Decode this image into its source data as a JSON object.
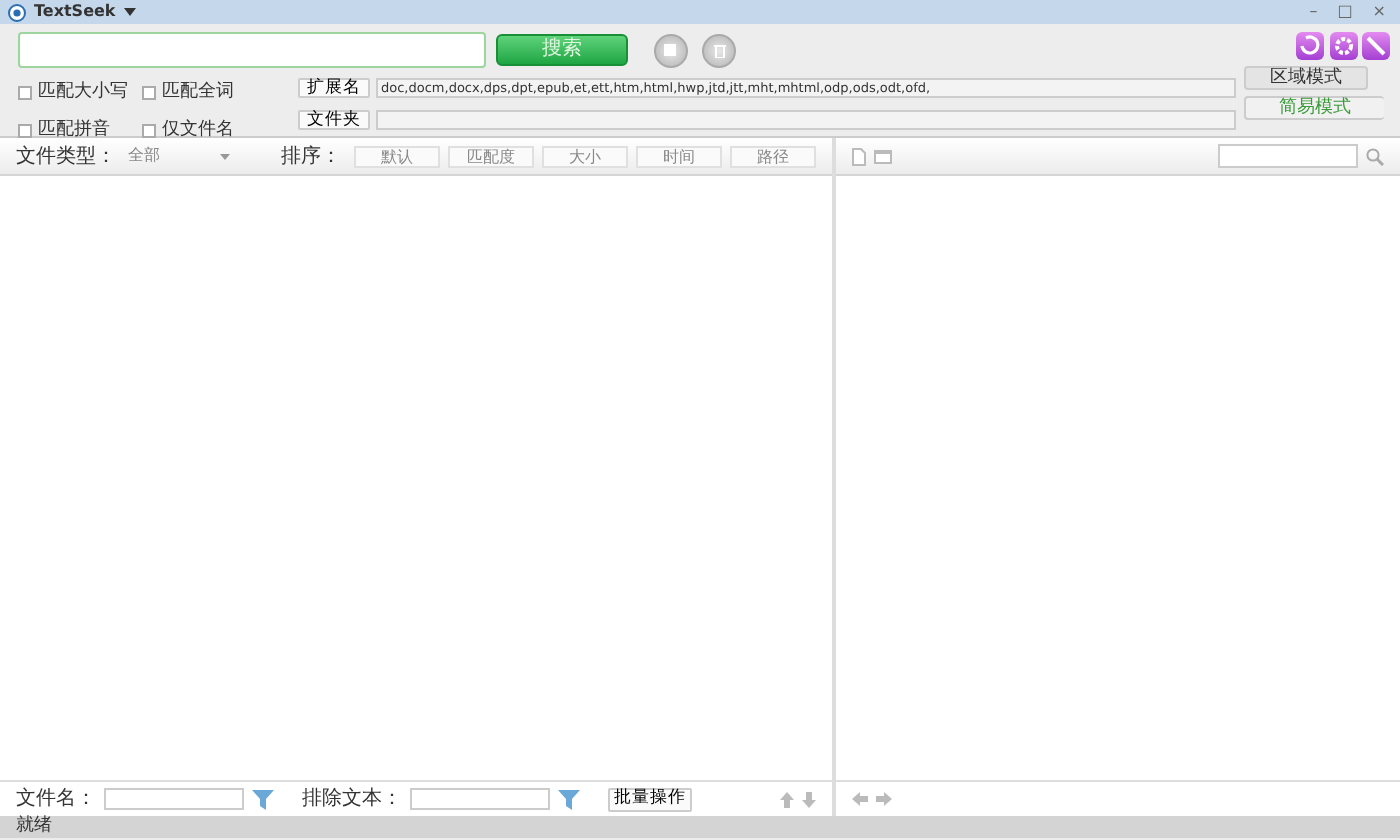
{
  "window": {
    "title": "TextSeek",
    "controls": [
      "–",
      "□",
      "×"
    ]
  },
  "search_button": "搜索",
  "options": [
    {
      "label": "匹配大小写",
      "checked": false
    },
    {
      "label": "匹配全词",
      "checked": false
    },
    {
      "label": "匹配拼音",
      "checked": false
    },
    {
      "label": "仅文件名",
      "checked": false
    }
  ],
  "filters": [
    {
      "label": "扩展名",
      "value": "doc,docm,docx,dps,dpt,epub,et,ett,htm,html,hwp,jtd,jtt,mht,mhtml,odp,ods,odt,ofd,"
    },
    {
      "label": "文件夹"
    }
  ],
  "modes": [
    {
      "label": "区域模式",
      "selected": false
    },
    {
      "label": "简易模式",
      "selected": true
    }
  ],
  "file_type": {
    "label": "文件类型：",
    "value": "全部"
  },
  "sort": {
    "label": "排序：",
    "options": [
      "默认",
      "匹配度",
      "大小",
      "时间",
      "路径"
    ]
  },
  "bottom": {
    "filename_label": "文件名：",
    "exclude_label": "排除文本：",
    "batch_button": "批量操作"
  },
  "status_bar": "就绪"
}
